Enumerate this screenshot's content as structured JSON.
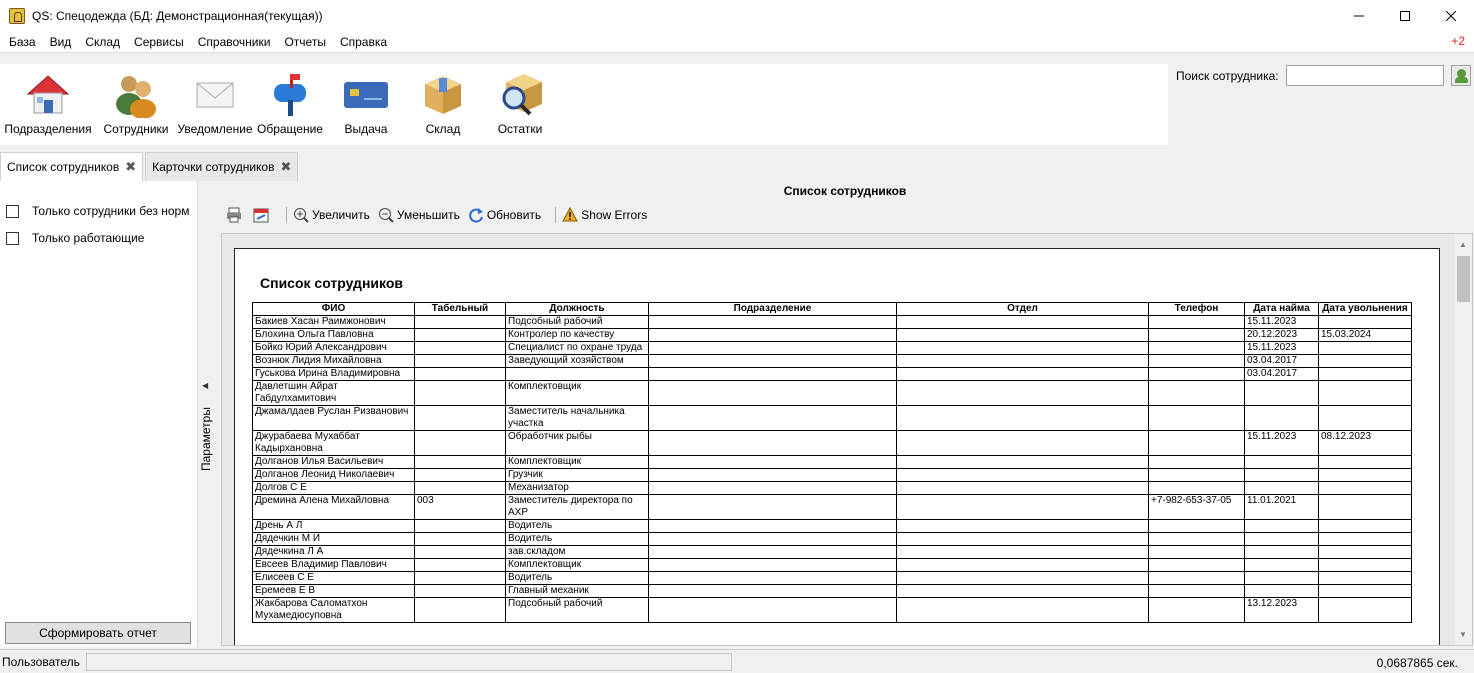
{
  "window": {
    "title": "QS: Спецодежда (БД: Демонстрационная(текущая))"
  },
  "menu": [
    "База",
    "Вид",
    "Склад",
    "Сервисы",
    "Справочники",
    "Отчеты",
    "Справка"
  ],
  "notification": "+2",
  "toolbar": [
    {
      "label": "Подразделения",
      "icon": "house-icon"
    },
    {
      "label": "Сотрудники",
      "icon": "people-icon"
    },
    {
      "label": "Уведомление",
      "icon": "envelope-icon"
    },
    {
      "label": "Обращение",
      "icon": "mailbox-icon"
    },
    {
      "label": "Выдача",
      "icon": "card-icon"
    },
    {
      "label": "Склад",
      "icon": "box-icon"
    },
    {
      "label": "Остатки",
      "icon": "magnifier-box-icon"
    }
  ],
  "search": {
    "label": "Поиск сотрудника:",
    "value": ""
  },
  "tabs": [
    {
      "label": "Список сотрудников",
      "active": true
    },
    {
      "label": "Карточки сотрудников",
      "active": false
    }
  ],
  "params": {
    "checkbox1": "Только сотрудники без норм",
    "checkbox2": "Только работающие",
    "button": "Сформировать отчет",
    "splitter_label": "Параметры"
  },
  "report": {
    "header": "Список сотрудников",
    "toolbar": {
      "zoom_in": "Увеличить",
      "zoom_out": "Уменьшить",
      "refresh": "Обновить",
      "errors": "Show Errors"
    },
    "title": "Список сотрудников",
    "columns": [
      "ФИО",
      "Табельный",
      "Должность",
      "Подразделение",
      "Отдел",
      "Телефон",
      "Дата найма",
      "Дата увольнения"
    ],
    "rows": [
      [
        "Бакиев Хасан Раимжонович",
        "",
        "Подсобный рабочий",
        "",
        "",
        "",
        "15.11.2023",
        ""
      ],
      [
        "Блохина Ольга Павловна",
        "",
        "Контролер по качеству",
        "",
        "",
        "",
        "20.12.2023",
        "15.03.2024"
      ],
      [
        "Бойко Юрий Александрович",
        "",
        "Специалист по охране труда",
        "",
        "",
        "",
        "15.11.2023",
        ""
      ],
      [
        "Вознюк Лидия Михайловна",
        "",
        "Заведующий хозяйством",
        "",
        "",
        "",
        "03.04.2017",
        ""
      ],
      [
        "Гуськова Ирина Владимировна",
        "",
        "",
        "",
        "",
        "",
        "03.04.2017",
        ""
      ],
      [
        "Давлетшин Айрат Габдулхамитович",
        "",
        "Комплектовщик",
        "",
        "",
        "",
        "",
        ""
      ],
      [
        "Джамалдаев Руслан Ризванович",
        "",
        "Заместитель начальника участка",
        "",
        "",
        "",
        "",
        ""
      ],
      [
        "Джурабаева Мухаббат Кадырхановна",
        "",
        "Обработчик рыбы",
        "",
        "",
        "",
        "15.11.2023",
        "08.12.2023"
      ],
      [
        "Долганов Илья Васильевич",
        "",
        "Комплектовщик",
        "",
        "",
        "",
        "",
        ""
      ],
      [
        "Долганов Леонид Николаевич",
        "",
        "Грузчик",
        "",
        "",
        "",
        "",
        ""
      ],
      [
        "Долгов С Е",
        "",
        "Механизатор",
        "",
        "",
        "",
        "",
        ""
      ],
      [
        "Дремина Алена Михайловна",
        "003",
        "Заместитель директора по АХР",
        "",
        "",
        "+7-982-653-37-05",
        "11.01.2021",
        ""
      ],
      [
        "Дрень А Л",
        "",
        "Водитель",
        "",
        "",
        "",
        "",
        ""
      ],
      [
        "Дядечкин М И",
        "",
        "Водитель",
        "",
        "",
        "",
        "",
        ""
      ],
      [
        "Дядечкина Л А",
        "",
        "зав.складом",
        "",
        "",
        "",
        "",
        ""
      ],
      [
        "Евсеев Владимир Павлович",
        "",
        "Комплектовщик",
        "",
        "",
        "",
        "",
        ""
      ],
      [
        "Елисеев С Е",
        "",
        "Водитель",
        "",
        "",
        "",
        "",
        ""
      ],
      [
        "Еремеев Е В",
        "",
        "Главный механик",
        "",
        "",
        "",
        "",
        ""
      ],
      [
        "Жакбарова Саломатхон Мухамедюсуповна",
        "",
        "Подсобный рабочий",
        "",
        "",
        "",
        "13.12.2023",
        ""
      ]
    ]
  },
  "status": {
    "user_label": "Пользователь",
    "time": "0,0687865 сек."
  },
  "colors": {
    "accent_red": "#e02020"
  }
}
